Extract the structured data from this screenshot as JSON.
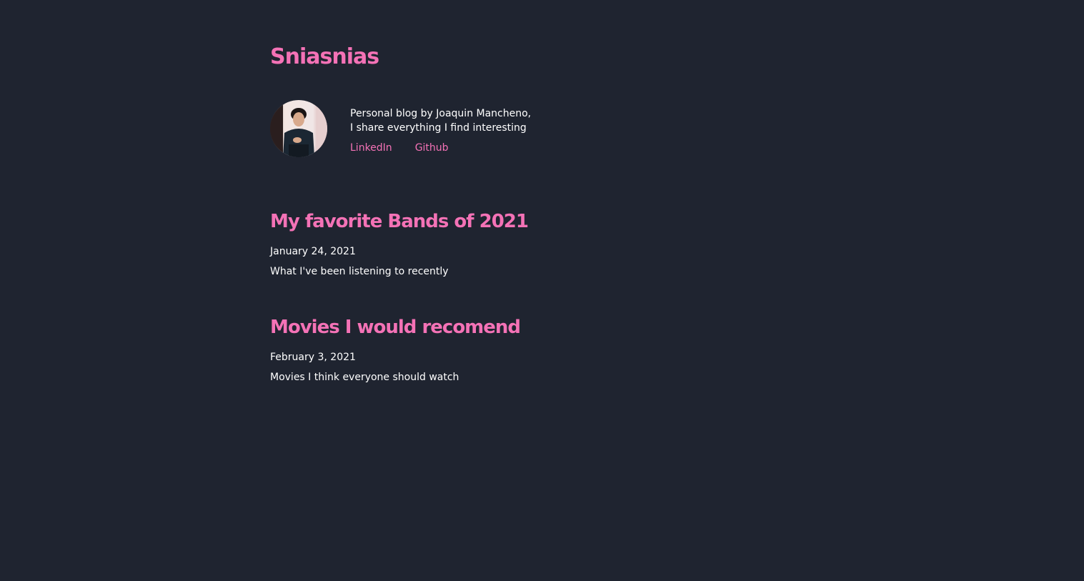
{
  "site": {
    "title": "Sniasnias"
  },
  "bio": {
    "line1": "Personal blog by Joaquin Mancheno,",
    "line2": "I share everything I find interesting",
    "links": [
      {
        "label": "LinkedIn"
      },
      {
        "label": "Github"
      }
    ]
  },
  "posts": [
    {
      "title": "My favorite Bands of 2021",
      "date": "January 24, 2021",
      "excerpt": "What I've been listening to recently"
    },
    {
      "title": "Movies I would recomend",
      "date": "February 3, 2021",
      "excerpt": "Movies I think everyone should watch"
    }
  ],
  "colors": {
    "background": "#1f2430",
    "accent": "#f472b6",
    "text": "#ffffff"
  }
}
